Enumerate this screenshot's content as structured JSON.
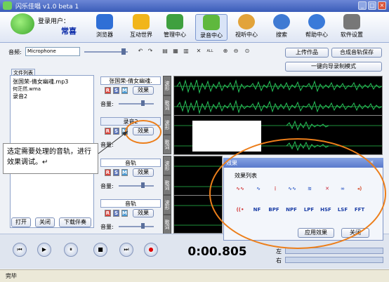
{
  "window": {
    "title": "闪乐佳唱 v1.0 beta 1"
  },
  "user": {
    "label": "登录用户：",
    "name": "常喜"
  },
  "toolbar": {
    "items": [
      {
        "label": "浏览器",
        "icon": "globe-icon",
        "color": "#2f6fd6"
      },
      {
        "label": "互动世界",
        "icon": "star-icon",
        "color": "#f1b51a"
      },
      {
        "label": "管理中心",
        "icon": "manage-icon",
        "color": "#3fa03f"
      },
      {
        "label": "录音中心",
        "icon": "record-icon",
        "color": "#5fb83d",
        "active": true
      },
      {
        "label": "视听中心",
        "icon": "cd-icon",
        "color": "#e2a33a"
      },
      {
        "label": "搜索",
        "icon": "search-icon",
        "color": "#3f7ad3"
      },
      {
        "label": "帮助中心",
        "icon": "help-icon",
        "color": "#3a7ad9"
      },
      {
        "label": "软件设置",
        "icon": "settings-icon",
        "color": "#777"
      }
    ]
  },
  "controls": {
    "input_label": "音频:",
    "input_value": "Microphone",
    "upload": "上传作品",
    "merge_save": "合成音轨保存",
    "import_mode": "一键向导录制模式"
  },
  "filelist": {
    "tab_label": "文件列表",
    "items": [
      "张国荣-倩女幽魂.mp3",
      "何茫然.wma",
      "录音2"
    ],
    "open": "打开",
    "close": "关闭",
    "download": "下载伴奏"
  },
  "tracks": [
    {
      "name": "张国荣-倩女幽魂.",
      "effect": "效果",
      "volume": "音量:"
    },
    {
      "name": "录音2",
      "effect": "效果",
      "volume": "音量:"
    },
    {
      "name": "音轨",
      "effect": "效果",
      "volume": "音量:"
    },
    {
      "name": "音轨",
      "effect": "效果",
      "volume": "音量:"
    }
  ],
  "rsm": {
    "r": "R",
    "s": "S",
    "m": "M"
  },
  "vtabs": {
    "top": "波形",
    "bottom": "歌词"
  },
  "timecode": "0:00.805",
  "levels": {
    "left": "左",
    "right": "右"
  },
  "status": "完毕",
  "callout": "选定需要处理的音轨，进行效果调试。↵",
  "dialog": {
    "title": "效果",
    "list_label": "效果列表",
    "labeled": [
      "NF",
      "BPF",
      "NPF",
      "LPF",
      "HSF",
      "LSF",
      "FFT"
    ],
    "apply": "应用效果",
    "close": "关闭"
  }
}
